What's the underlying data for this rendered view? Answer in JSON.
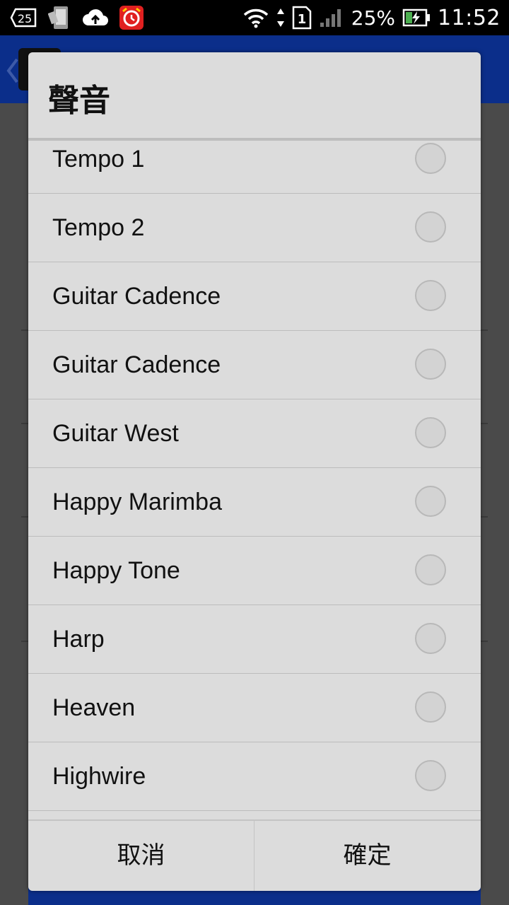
{
  "status_bar": {
    "notification_badge": "25",
    "battery_percent": "25%",
    "time": "11:52",
    "sim_slot": "1",
    "icons": [
      "notification-count-icon",
      "phone-icon",
      "cloud-upload-icon",
      "alarm-app-icon",
      "wifi-icon",
      "data-arrows-icon",
      "sim-icon",
      "signal-icon",
      "battery-charging-icon"
    ]
  },
  "dialog": {
    "title": "聲音",
    "items": [
      {
        "label": "Tempo 1",
        "selected": false
      },
      {
        "label": "Tempo 2",
        "selected": false
      },
      {
        "label": "Guitar Cadence",
        "selected": false
      },
      {
        "label": "Guitar Cadence",
        "selected": false
      },
      {
        "label": "Guitar West",
        "selected": false
      },
      {
        "label": "Happy Marimba",
        "selected": false
      },
      {
        "label": "Happy Tone",
        "selected": false
      },
      {
        "label": "Harp",
        "selected": false
      },
      {
        "label": "Heaven",
        "selected": false
      },
      {
        "label": "Highwire",
        "selected": false
      }
    ],
    "cancel_label": "取消",
    "ok_label": "確定"
  },
  "colors": {
    "action_bar": "#0b2e8a",
    "dialog_bg": "#dcdcdc",
    "status_bar": "#000000"
  }
}
